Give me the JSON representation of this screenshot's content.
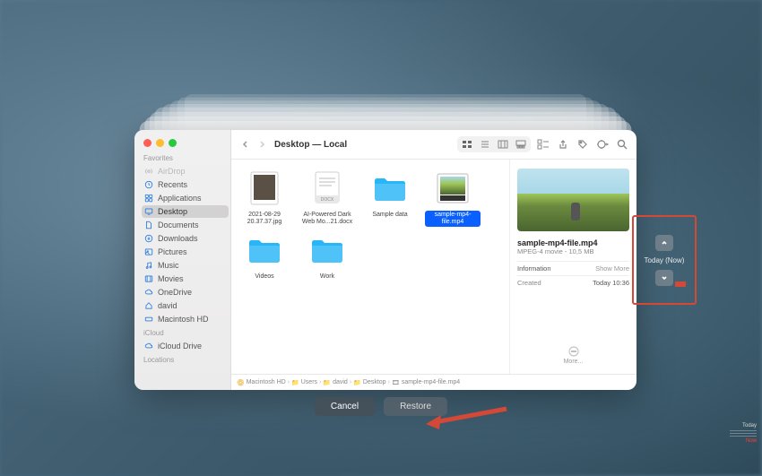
{
  "window_title": "Desktop — Local",
  "sidebar": {
    "favorites_header": "Favorites",
    "icloud_header": "iCloud",
    "locations_header": "Locations",
    "items": [
      {
        "label": "AirDrop"
      },
      {
        "label": "Recents"
      },
      {
        "label": "Applications"
      },
      {
        "label": "Desktop"
      },
      {
        "label": "Documents"
      },
      {
        "label": "Downloads"
      },
      {
        "label": "Pictures"
      },
      {
        "label": "Music"
      },
      {
        "label": "Movies"
      },
      {
        "label": "OneDrive"
      },
      {
        "label": "david"
      },
      {
        "label": "Macintosh HD"
      }
    ],
    "icloud": [
      {
        "label": "iCloud Drive"
      }
    ]
  },
  "files": [
    {
      "label": "2021-08-29 20.37.37.jpg",
      "kind": "image"
    },
    {
      "label": "AI-Powered Dark Web Mo...21.docx",
      "kind": "docx"
    },
    {
      "label": "Sample data",
      "kind": "folder"
    },
    {
      "label": "sample-mp4-file.mp4",
      "kind": "video",
      "selected": true
    },
    {
      "label": "Videos",
      "kind": "folder"
    },
    {
      "label": "Work",
      "kind": "folder"
    }
  ],
  "preview": {
    "name": "sample-mp4-file.mp4",
    "sub": "MPEG-4 movie - 10,5 MB",
    "info_label": "Information",
    "show_more_label": "Show More",
    "created_label": "Created",
    "created_value": "Today 10:36",
    "more_label": "More..."
  },
  "path": [
    "Macintosh HD",
    "Users",
    "david",
    "Desktop",
    "sample-mp4-file.mp4"
  ],
  "buttons": {
    "cancel": "Cancel",
    "restore": "Restore"
  },
  "tmnav": {
    "label": "Today (Now)"
  },
  "timeline": {
    "today": "Today",
    "now": "Now"
  }
}
